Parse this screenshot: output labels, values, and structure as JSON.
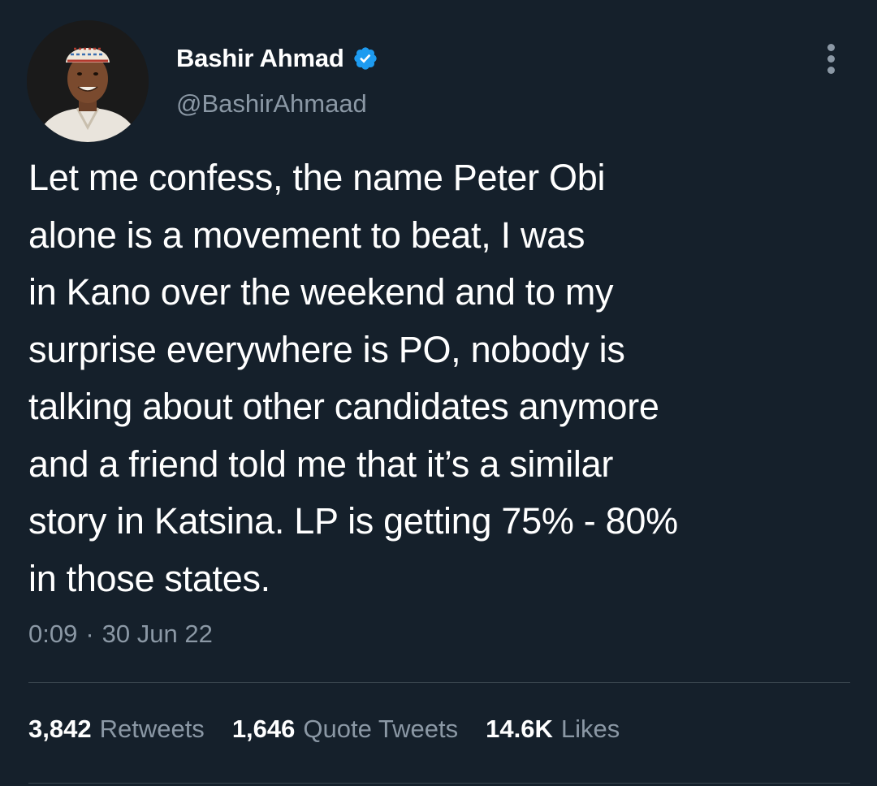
{
  "author": {
    "display_name": "Bashir Ahmad",
    "handle": "@BashirAhmaad",
    "avatar_icon": "profile-photo",
    "verified_icon": "verified-badge-icon",
    "verified_color": "#1d9bf0"
  },
  "tweet": {
    "lines": [
      "Let me confess, the name Peter Obi",
      "alone is a movement to beat, I was",
      "in Kano over the weekend and to my",
      "surprise everywhere is PO, nobody is",
      "talking about other candidates anymore",
      "and a friend told me that it’s a similar",
      "story in Katsina. LP is getting 75% - 80%",
      "in those states."
    ],
    "time": "0:09",
    "separator": "·",
    "date": "30 Jun 22"
  },
  "stats": {
    "retweets": {
      "count": "3,842",
      "label": "Retweets"
    },
    "quotes": {
      "count": "1,646",
      "label": "Quote Tweets"
    },
    "likes": {
      "count": "14.6K",
      "label": "Likes"
    }
  },
  "menu": {
    "icon": "more-options-icon"
  },
  "colors": {
    "background": "#15202b",
    "primary_text": "#ffffff",
    "secondary_text": "#8b98a5",
    "divider": "#38444d"
  }
}
